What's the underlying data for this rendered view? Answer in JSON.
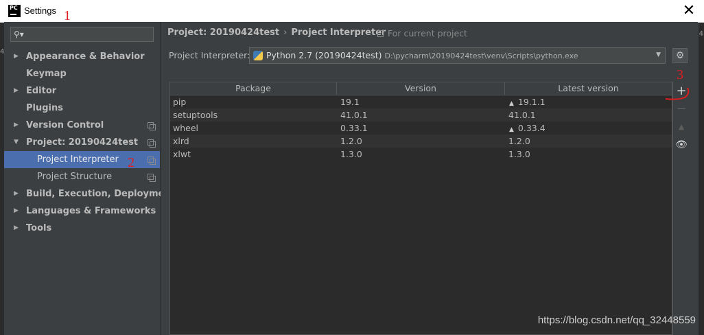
{
  "window": {
    "title": "Settings",
    "close_glyph": "✕",
    "icon_text": "PC"
  },
  "annotations": [
    "1",
    "2",
    "3"
  ],
  "sidebar": {
    "search_placeholder": "",
    "search_glyph": "🔍▾",
    "items": [
      {
        "label": "Appearance & Behavior",
        "expandable": true,
        "bold": true
      },
      {
        "label": "Keymap",
        "expandable": false,
        "bold": true
      },
      {
        "label": "Editor",
        "expandable": true,
        "bold": true
      },
      {
        "label": "Plugins",
        "expandable": false,
        "bold": true
      },
      {
        "label": "Version Control",
        "expandable": true,
        "bold": true,
        "copy_icon": true
      },
      {
        "label": "Project: 20190424test",
        "expandable": true,
        "expanded": true,
        "bold": true,
        "copy_icon": true
      },
      {
        "label": "Project Interpreter",
        "child": true,
        "selected": true,
        "copy_icon": true
      },
      {
        "label": "Project Structure",
        "child": true,
        "copy_icon": true
      },
      {
        "label": "Build, Execution, Deployment",
        "expandable": true,
        "bold": true
      },
      {
        "label": "Languages & Frameworks",
        "expandable": true,
        "bold": true
      },
      {
        "label": "Tools",
        "expandable": true,
        "bold": true
      }
    ]
  },
  "main": {
    "breadcrumb": {
      "project": "Project: 20190424test",
      "separator": "›",
      "page": "Project Interpreter"
    },
    "scope_hint": "For current project",
    "interpreter": {
      "label": "Project Interpreter:",
      "name": "Python 2.7 (20190424test)",
      "path": "D:\\pycharm\\20190424test\\venv\\Scripts\\python.exe"
    },
    "table": {
      "columns": [
        "Package",
        "Version",
        "Latest version"
      ],
      "rows": [
        {
          "package": "pip",
          "version": "19.1",
          "latest": "19.1.1",
          "upgrade": true
        },
        {
          "package": "setuptools",
          "version": "41.0.1",
          "latest": "41.0.1",
          "upgrade": false
        },
        {
          "package": "wheel",
          "version": "0.33.1",
          "latest": "0.33.4",
          "upgrade": true
        },
        {
          "package": "xlrd",
          "version": "1.2.0",
          "latest": "1.2.0",
          "upgrade": false
        },
        {
          "package": "xlwt",
          "version": "1.3.0",
          "latest": "1.3.0",
          "upgrade": false
        }
      ]
    },
    "toolbar": {
      "add": "+",
      "remove": "−",
      "upgrade": "▲",
      "show_early": "👁"
    }
  },
  "watermark": "https://blog.csdn.net/qq_32448559",
  "colors": {
    "accent": "#4b6eaf",
    "annotation": "#e01e1e",
    "background": "#3c3f41",
    "table_bg": "#2b2b2b"
  }
}
